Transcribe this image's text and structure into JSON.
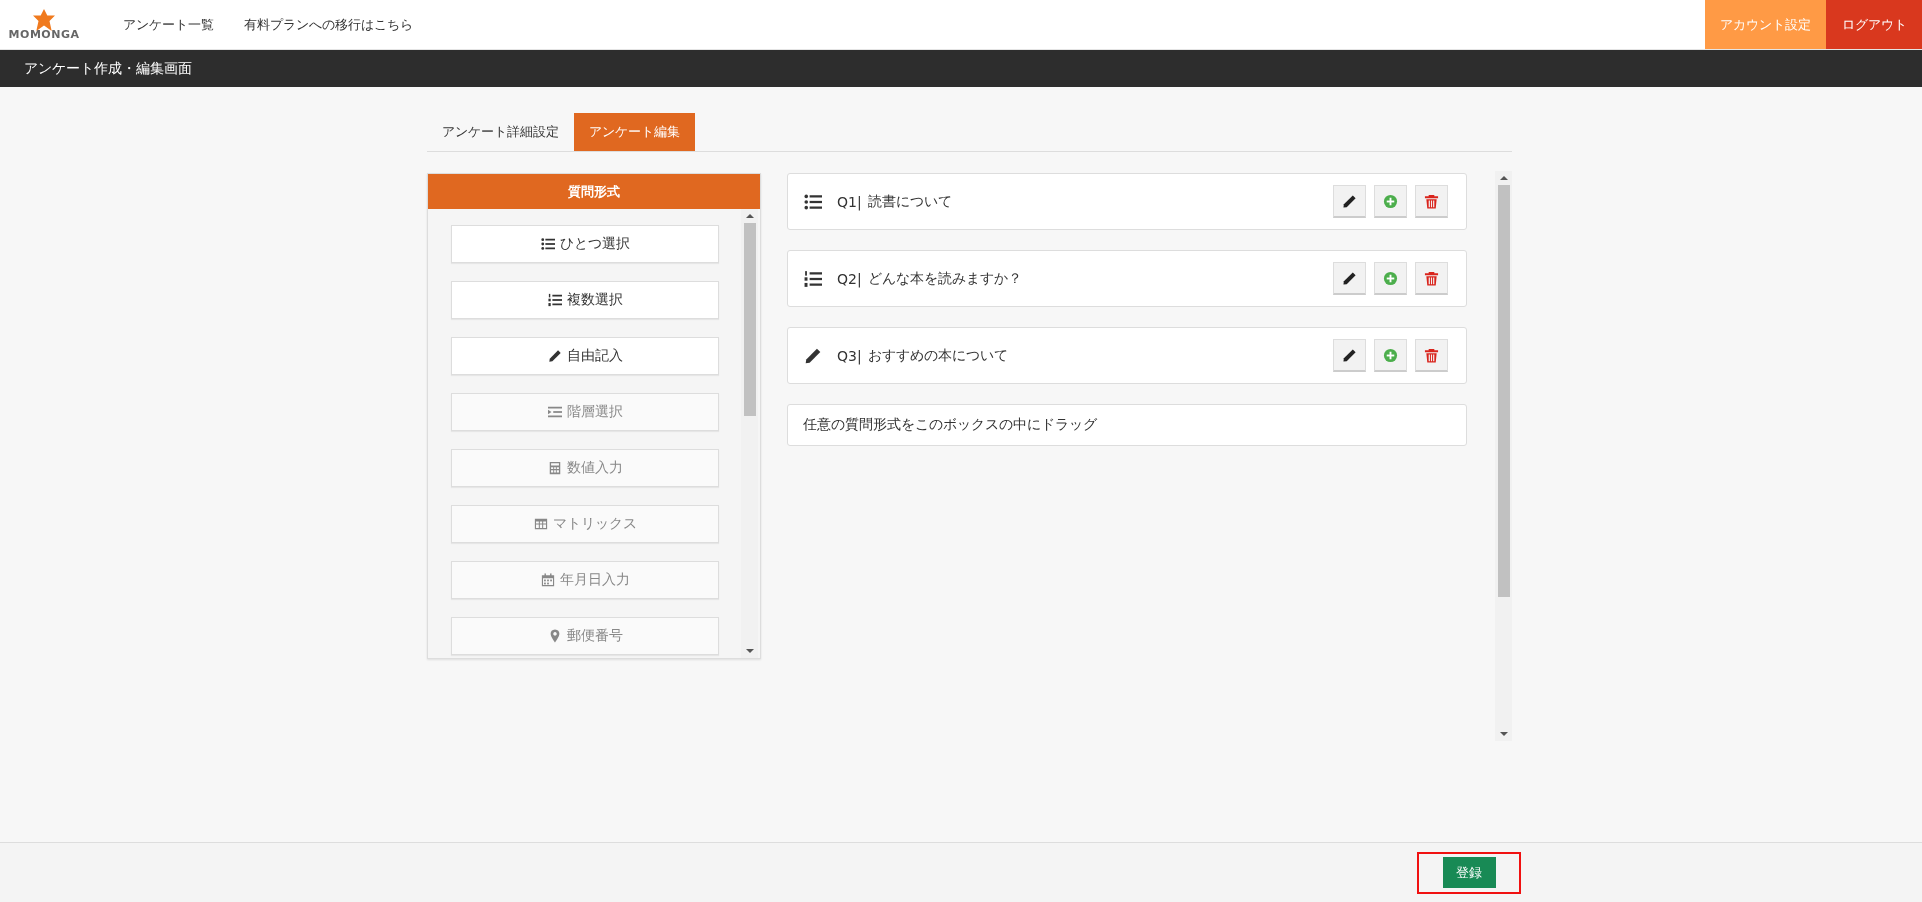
{
  "header": {
    "logo": "MOMONGA",
    "nav": [
      {
        "label": "アンケート一覧"
      },
      {
        "label": "有料プランへの移行はこちら"
      }
    ],
    "account_button": "アカウント設定",
    "logout_button": "ログアウト"
  },
  "page_title": "アンケート作成・編集画面",
  "tabs": [
    {
      "label": "アンケート詳細設定",
      "selected": false
    },
    {
      "label": "アンケート編集",
      "selected": true
    }
  ],
  "question_types": {
    "title": "質問形式",
    "items": [
      {
        "label": "ひとつ選択",
        "kind": "single",
        "disabled": false
      },
      {
        "label": "複数選択",
        "kind": "multiple",
        "disabled": false
      },
      {
        "label": "自由記入",
        "kind": "text",
        "disabled": false
      },
      {
        "label": "階層選択",
        "kind": "hierarchy",
        "disabled": true
      },
      {
        "label": "数値入力",
        "kind": "number",
        "disabled": true
      },
      {
        "label": "マトリックス",
        "kind": "matrix",
        "disabled": true
      },
      {
        "label": "年月日入力",
        "kind": "date",
        "disabled": true
      },
      {
        "label": "郵便番号",
        "kind": "postal",
        "disabled": true
      }
    ]
  },
  "questions": [
    {
      "number": "Q1|",
      "title": "読書について",
      "kind": "single"
    },
    {
      "number": "Q2|",
      "title": "どんな本を読みますか？",
      "kind": "multiple"
    },
    {
      "number": "Q3|",
      "title": "おすすめの本について",
      "kind": "text"
    }
  ],
  "drop_zone": "任意の質問形式をこのボックスの中にドラッグ",
  "footer": {
    "submit_button": "登録",
    "highlighted": true
  }
}
